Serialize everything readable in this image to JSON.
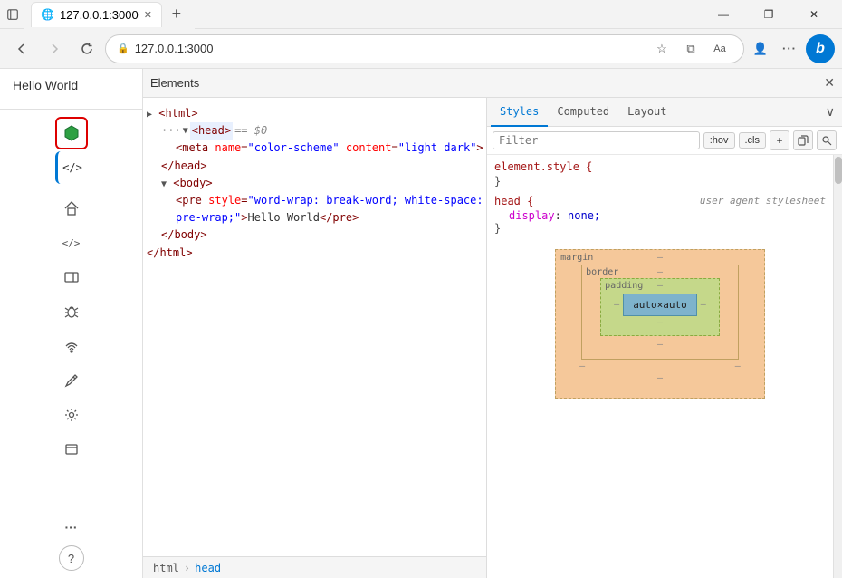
{
  "titlebar": {
    "tab_label": "127.0.0.1:3000",
    "new_tab_icon": "+",
    "minimize": "—",
    "restore": "❐",
    "close": "✕"
  },
  "addressbar": {
    "back_icon": "←",
    "forward_icon": "→",
    "refresh_icon": "↻",
    "lock_icon": "🔒",
    "url": "127.0.0.1:3000",
    "favorites_icon": "☆",
    "split_icon": "⧉",
    "profile_icon": "👤",
    "more_icon": "···",
    "bing_label": "b"
  },
  "browser": {
    "hello_world": "Hello World"
  },
  "sidebar": {
    "icons": [
      {
        "name": "elements-icon",
        "symbol": "⬡",
        "active": true,
        "active_type": "red-border"
      },
      {
        "name": "console-icon",
        "symbol": "</>",
        "active_blue": true
      },
      {
        "name": "network-icon",
        "symbol": "⊡"
      },
      {
        "name": "home-icon",
        "symbol": "⌂"
      },
      {
        "name": "sources-icon",
        "symbol": "</>"
      },
      {
        "name": "responsive-icon",
        "symbol": "⬜"
      },
      {
        "name": "bug-icon",
        "symbol": "🐛"
      },
      {
        "name": "wifi-icon",
        "symbol": "⌻"
      },
      {
        "name": "pen-icon",
        "symbol": "✐"
      },
      {
        "name": "settings-icon",
        "symbol": "⚙"
      },
      {
        "name": "window-icon",
        "symbol": "☐"
      }
    ],
    "bottom_icons": [
      {
        "name": "more-icon",
        "symbol": "···"
      },
      {
        "name": "help-icon",
        "symbol": "?"
      }
    ]
  },
  "devtools": {
    "title": "Elements",
    "close_icon": "✕",
    "elements": [
      {
        "indent": 0,
        "text": "<html>",
        "type": "tag"
      },
      {
        "indent": 1,
        "text": "<head>",
        "type": "selected",
        "suffix": " == $0"
      },
      {
        "indent": 2,
        "text": "<meta name=\"color-scheme\" content=\"light dark\">",
        "type": "tag"
      },
      {
        "indent": 1,
        "text": "</head>",
        "type": "tag"
      },
      {
        "indent": 1,
        "text": "<body>",
        "type": "tag",
        "triangle": "▼"
      },
      {
        "indent": 2,
        "text": "<pre style=\"word-wrap: break-word; white-space:",
        "type": "tag"
      },
      {
        "indent": 2,
        "text": "pre-wrap;\">Hello World</pre>",
        "type": "tag"
      },
      {
        "indent": 1,
        "text": "</body>",
        "type": "tag"
      },
      {
        "indent": 0,
        "text": "</html>",
        "type": "tag"
      }
    ],
    "breadcrumb": [
      {
        "label": "html",
        "active": false
      },
      {
        "label": "head",
        "active": true
      }
    ]
  },
  "styles_panel": {
    "tabs": [
      {
        "label": "Styles",
        "active": true
      },
      {
        "label": "Computed",
        "active": false
      },
      {
        "label": "Layout",
        "active": false
      }
    ],
    "filter_placeholder": "Filter",
    "filter_buttons": [
      ":hov",
      ".cls"
    ],
    "rules": [
      {
        "selector": "element.style {",
        "properties": [],
        "close": "}"
      },
      {
        "selector": "head {",
        "source": "user agent stylesheet",
        "properties": [
          {
            "name": "display",
            "value": "none;"
          }
        ],
        "close": "}"
      }
    ],
    "box_model": {
      "margin_label": "margin",
      "border_label": "border",
      "padding_label": "padding",
      "content_label": "auto×auto",
      "margin_top": "-",
      "margin_right": "-",
      "margin_bottom": "-",
      "margin_left": "-",
      "border_top": "-",
      "border_right": "-",
      "border_bottom": "-",
      "border_left": "-",
      "padding_top": "-",
      "padding_right": "-",
      "padding_bottom": "-",
      "padding_left": "-"
    }
  }
}
